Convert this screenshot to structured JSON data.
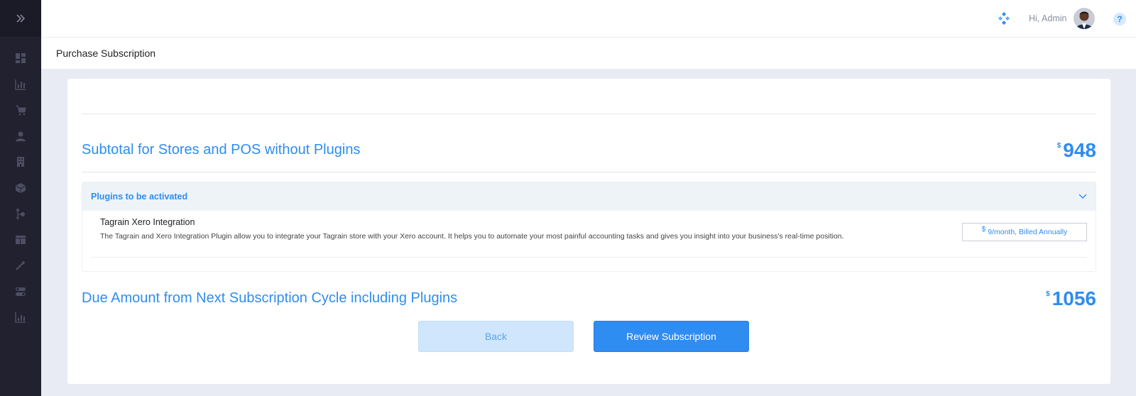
{
  "topbar": {
    "greeting": "Hi, Admin",
    "help_label": "?"
  },
  "page": {
    "title": "Purchase Subscription"
  },
  "subtotal": {
    "label": "Subtotal for Stores and POS without Plugins",
    "currency": "$",
    "amount": "948"
  },
  "plugins": {
    "header": "Plugins to be activated",
    "items": [
      {
        "name": "Tagrain Xero Integration",
        "description": "The Tagrain and Xero Integration Plugin allow you to integrate your Tagrain store with your Xero account. It helps you to automate your most painful accounting tasks and gives you insight into your business's real-time position.",
        "price_currency": "$",
        "price": "9/month, Billed Annually"
      }
    ]
  },
  "due": {
    "label": "Due Amount from Next Subscription Cycle including Plugins",
    "currency": "$",
    "amount": "1056"
  },
  "buttons": {
    "back": "Back",
    "review": "Review Subscription"
  },
  "colors": {
    "accent": "#2f8cf1",
    "sidebar": "#22212f",
    "background": "#e9ebf4"
  },
  "icons": {
    "sidebar_toggle": "double-chevron-right-icon",
    "sidebar": [
      "dashboard-icon",
      "bar-chart-icon",
      "cart-icon",
      "user-icon",
      "building-icon",
      "box-icon",
      "workflow-icon",
      "table-icon",
      "magic-wand-icon",
      "toggle-icon",
      "analytics-icon"
    ]
  }
}
